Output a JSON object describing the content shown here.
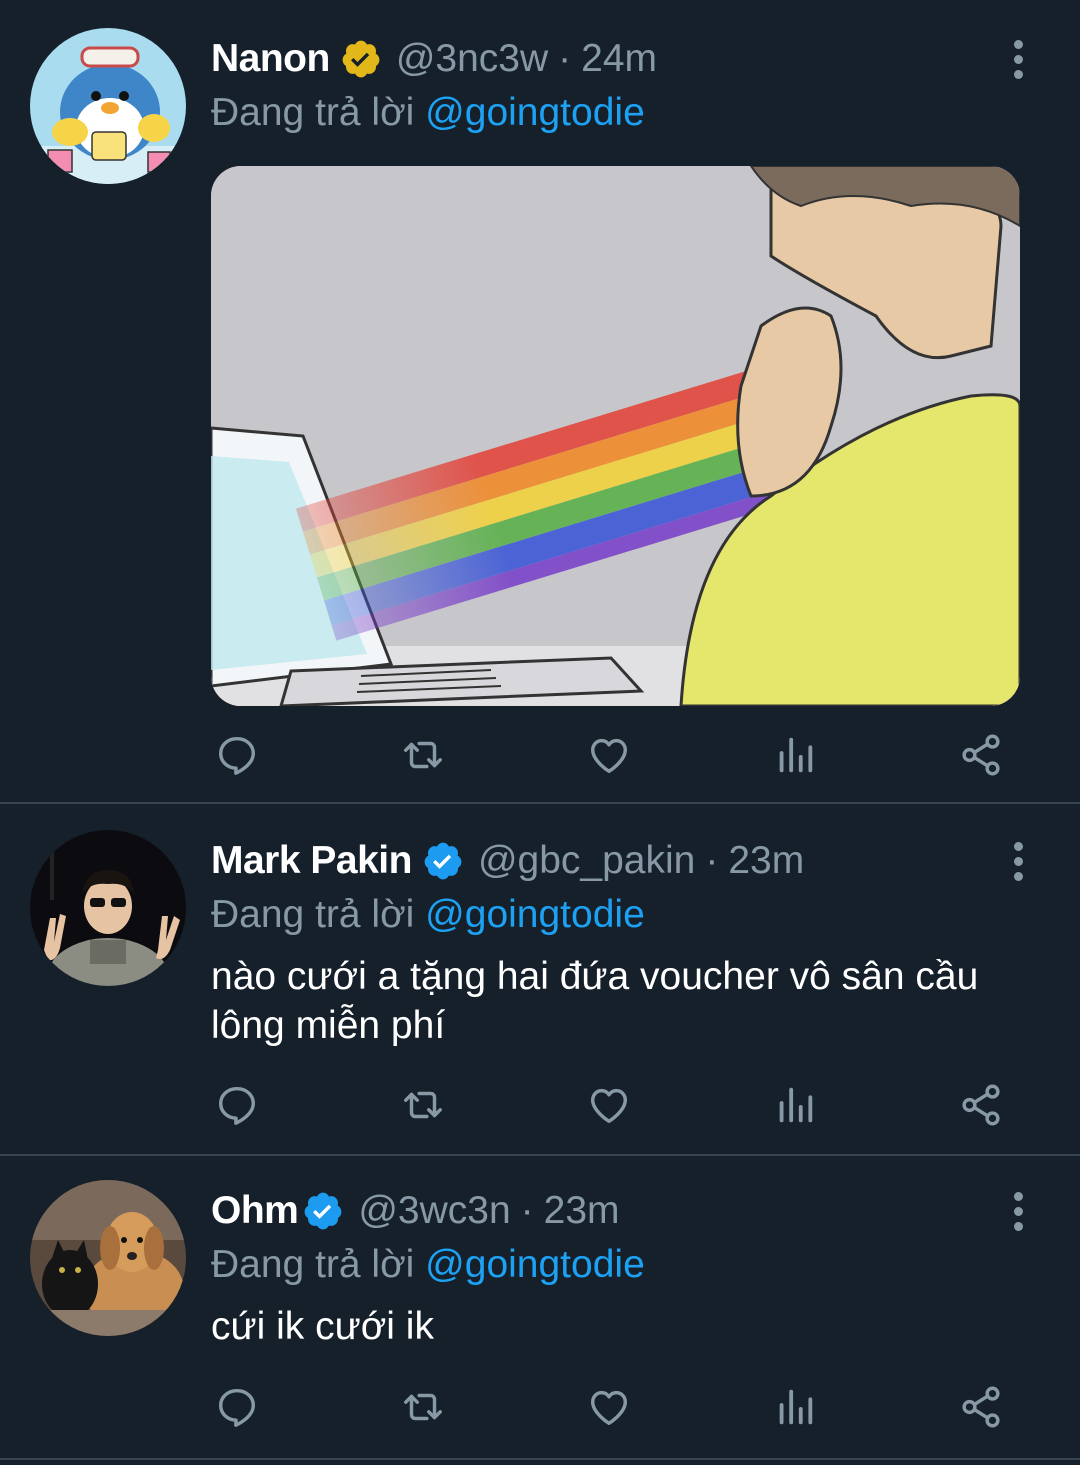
{
  "colors": {
    "background": "#15202b",
    "divider": "#38444d",
    "secondary_text": "#8899a6",
    "link": "#1da1f2",
    "verified_gold": "#e2b719",
    "verified_blue": "#1d9bf0"
  },
  "tweets": [
    {
      "name": "Nanon",
      "verified": "gold-verified-badge",
      "handle": "@3nc3w",
      "dot": "·",
      "time": "24m",
      "reply_prefix": "Đang trả lời",
      "reply_to": "@goingtodie",
      "text": "",
      "media": "meme-image",
      "avatar": "cartoon-penguin-avatar"
    },
    {
      "name": "Mark Pakin",
      "verified": "blue-verified-badge",
      "handle": "@gbc_pakin",
      "dot": "·",
      "time": "23m",
      "reply_prefix": "Đang trả lời",
      "reply_to": "@goingtodie",
      "text": "nào cưới a tặng hai đứa voucher vô sân cầu lông miễn phí",
      "avatar": "person-peace-sign-avatar"
    },
    {
      "name": "Ohm",
      "verified": "blue-verified-badge",
      "handle": "@3wc3n",
      "dot": "·",
      "time": "23m",
      "reply_prefix": "Đang trả lời",
      "reply_to": "@goingtodie",
      "text": "cứi ik cưới ik",
      "avatar": "dog-and-cat-avatar"
    }
  ],
  "action_icons": [
    "reply-icon",
    "retweet-icon",
    "like-icon",
    "analytics-icon",
    "share-icon"
  ]
}
